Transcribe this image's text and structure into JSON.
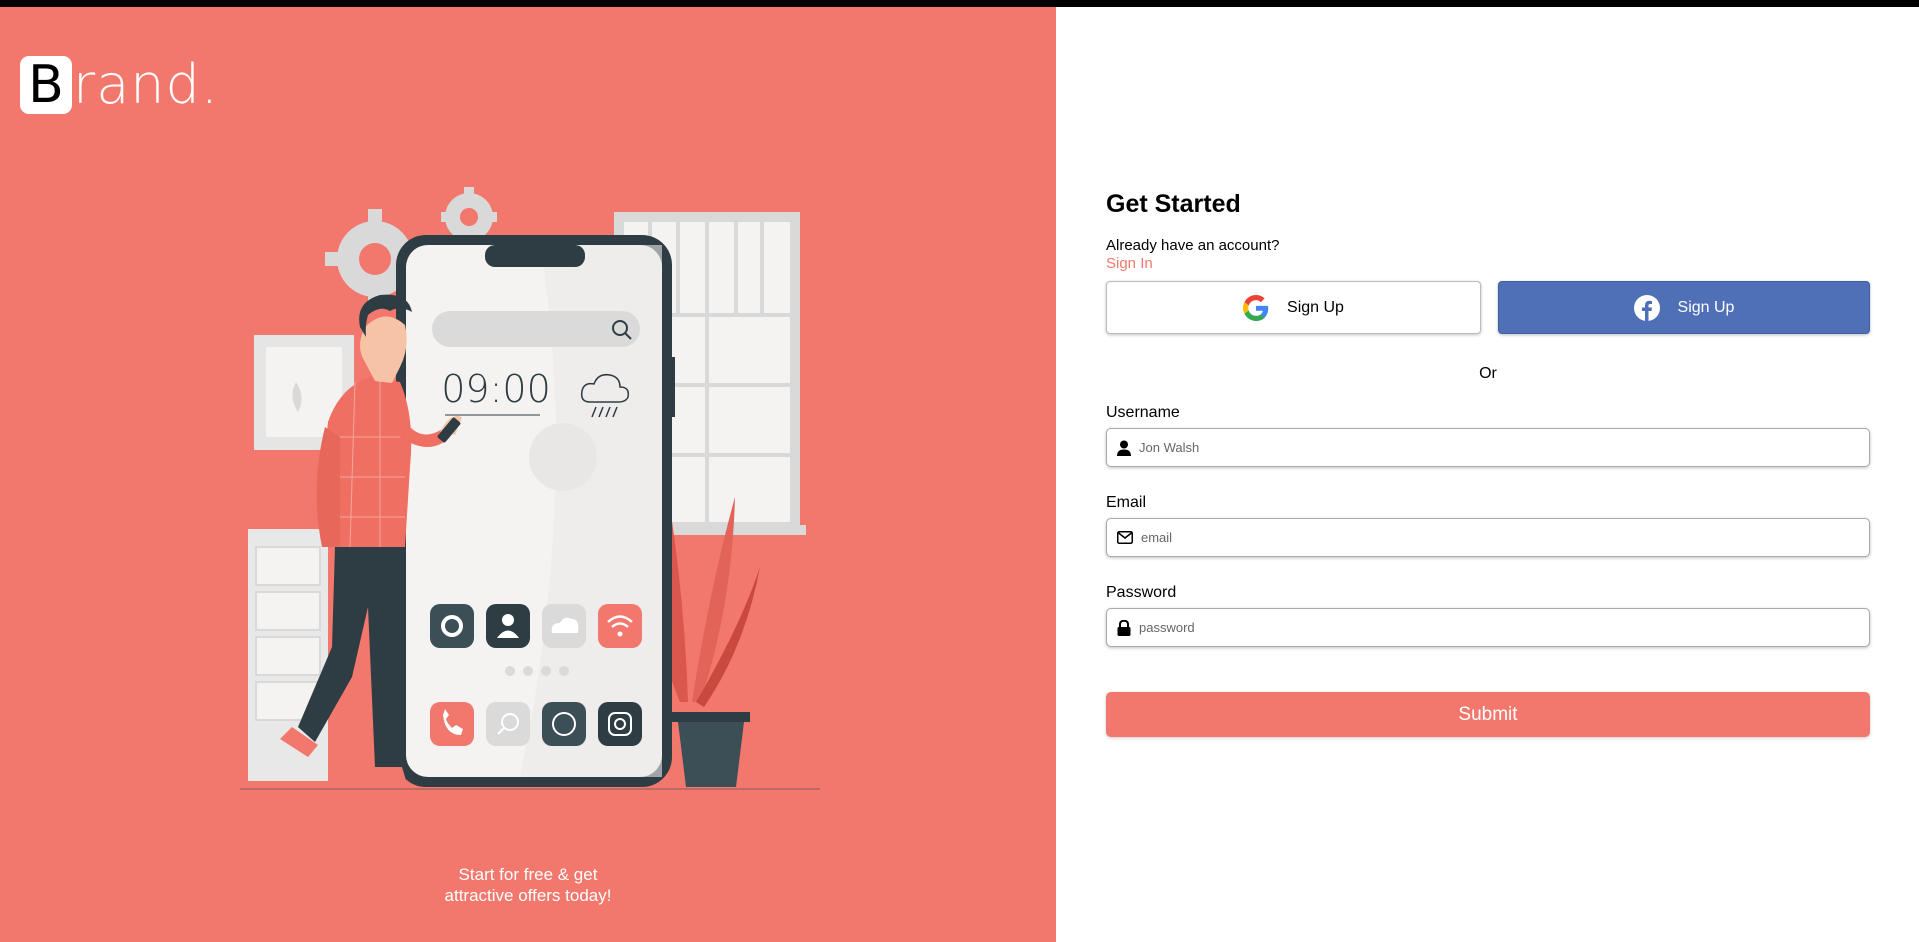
{
  "brand": {
    "letter": "B",
    "rest": "rand."
  },
  "hero": {
    "clock": "09:00"
  },
  "tagline": {
    "line1": "Start for free & get",
    "line2": "attractive offers today!"
  },
  "form": {
    "title": "Get Started",
    "already": "Already have an account?",
    "signin": "Sign In",
    "google_label": "Sign Up",
    "facebook_label": "Sign Up",
    "or": "Or",
    "username": {
      "label": "Username",
      "placeholder": "Jon Walsh"
    },
    "email": {
      "label": "Email",
      "placeholder": "email"
    },
    "password": {
      "label": "Password",
      "placeholder": "password"
    },
    "submit": "Submit"
  },
  "colors": {
    "accent": "#f2776c",
    "facebook": "#4f6fb7",
    "dark": "#2e3d44"
  },
  "icons": [
    "google-icon",
    "facebook-icon",
    "user-icon",
    "envelope-icon",
    "lock-icon"
  ]
}
